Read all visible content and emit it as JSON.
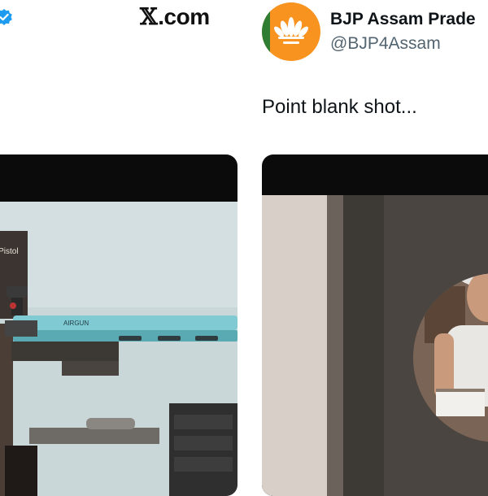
{
  "watermark": {
    "x_glyph": "𝕏",
    "site": ".com"
  },
  "left_tweet": {
    "verified_icon": "verified-badge-icon",
    "media_overlay_text": "r Pistol",
    "rifle_brand_text": "AIRGUN"
  },
  "right_tweet": {
    "display_name": "BJP Assam Prade",
    "handle": "@BJP4Assam",
    "text": "Point blank shot...",
    "avatar_icon": "lotus-logo-icon"
  },
  "colors": {
    "verified_blue": "#1d9bf0",
    "bjp_saffron": "#f7931e",
    "bjp_green": "#2e7d32",
    "handle_gray": "#536471"
  }
}
